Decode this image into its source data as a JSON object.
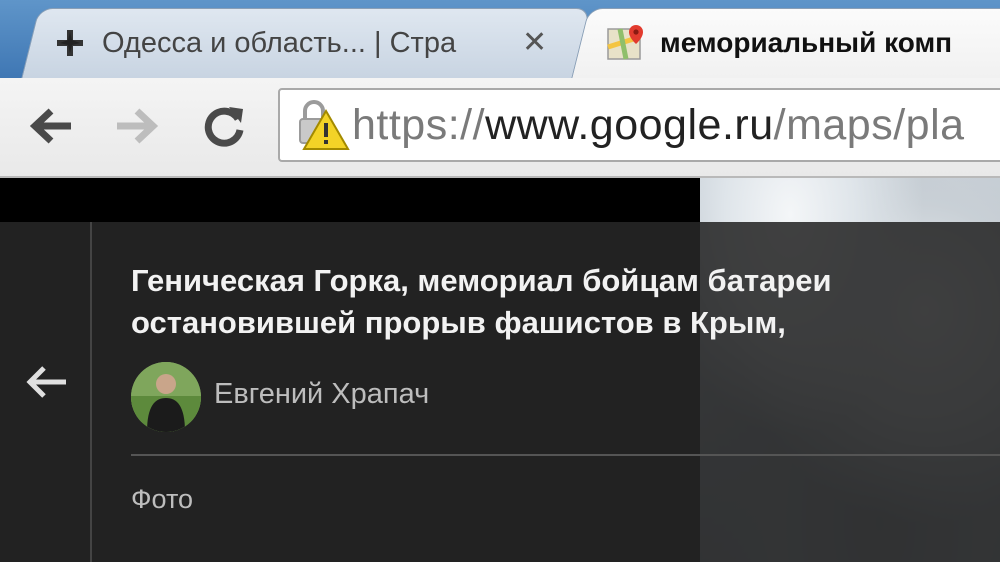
{
  "tabs": [
    {
      "title": "Одесса и область... | Стра",
      "active": false,
      "favicon": "cross-favicon-icon",
      "close": "✕"
    },
    {
      "title": "мемориальный комп",
      "active": true,
      "favicon": "google-maps-favicon-icon"
    }
  ],
  "toolbar": {
    "back": "back-arrow-icon",
    "forward": "forward-arrow-icon",
    "reload": "reload-icon",
    "omnibox": {
      "scheme": "https://",
      "host": "www.google.ru",
      "path": "/maps/pla",
      "security": "warning-lock-icon"
    }
  },
  "place": {
    "title_line1": "Геническая Горка, мемориал бойцам батареи",
    "title_line2": "остановившей прорыв фашистов в Крым,",
    "author": "Евгений Храпач",
    "section": "Фото"
  },
  "colors": {
    "tabstrip": "#4f86c0",
    "panel": "#222222",
    "title": "#f2f2f2",
    "secondary_text": "#bdbdbd"
  }
}
